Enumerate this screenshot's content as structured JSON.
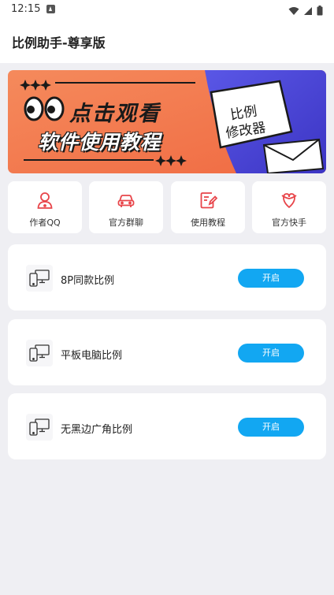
{
  "status_bar": {
    "time": "12:15",
    "icons": [
      "notification-a-icon",
      "wifi-icon",
      "signal-icon",
      "battery-icon"
    ]
  },
  "app_bar": {
    "title": "比例助手-尊享版"
  },
  "banner": {
    "headline_1": "点击观看",
    "headline_2": "软件使用教程",
    "note_line_1": "比例",
    "note_line_2": "修改器"
  },
  "quick_actions": [
    {
      "label": "作者QQ",
      "icon": "qq-person-icon"
    },
    {
      "label": "官方群聊",
      "icon": "car-icon"
    },
    {
      "label": "使用教程",
      "icon": "edit-document-icon"
    },
    {
      "label": "官方快手",
      "icon": "kuaishou-icon"
    }
  ],
  "ratio_items": [
    {
      "label": "8P同款比例",
      "button": "开启",
      "icon": "devices-icon"
    },
    {
      "label": "平板电脑比例",
      "button": "开启",
      "icon": "devices-icon"
    },
    {
      "label": "无黑边广角比例",
      "button": "开启",
      "icon": "devices-icon"
    }
  ],
  "colors": {
    "accent": "#12a7f2",
    "quick_icon": "#e8454a",
    "banner_orange": "#f27a4e",
    "banner_purple": "#4b47d6",
    "background": "#efeff3"
  }
}
